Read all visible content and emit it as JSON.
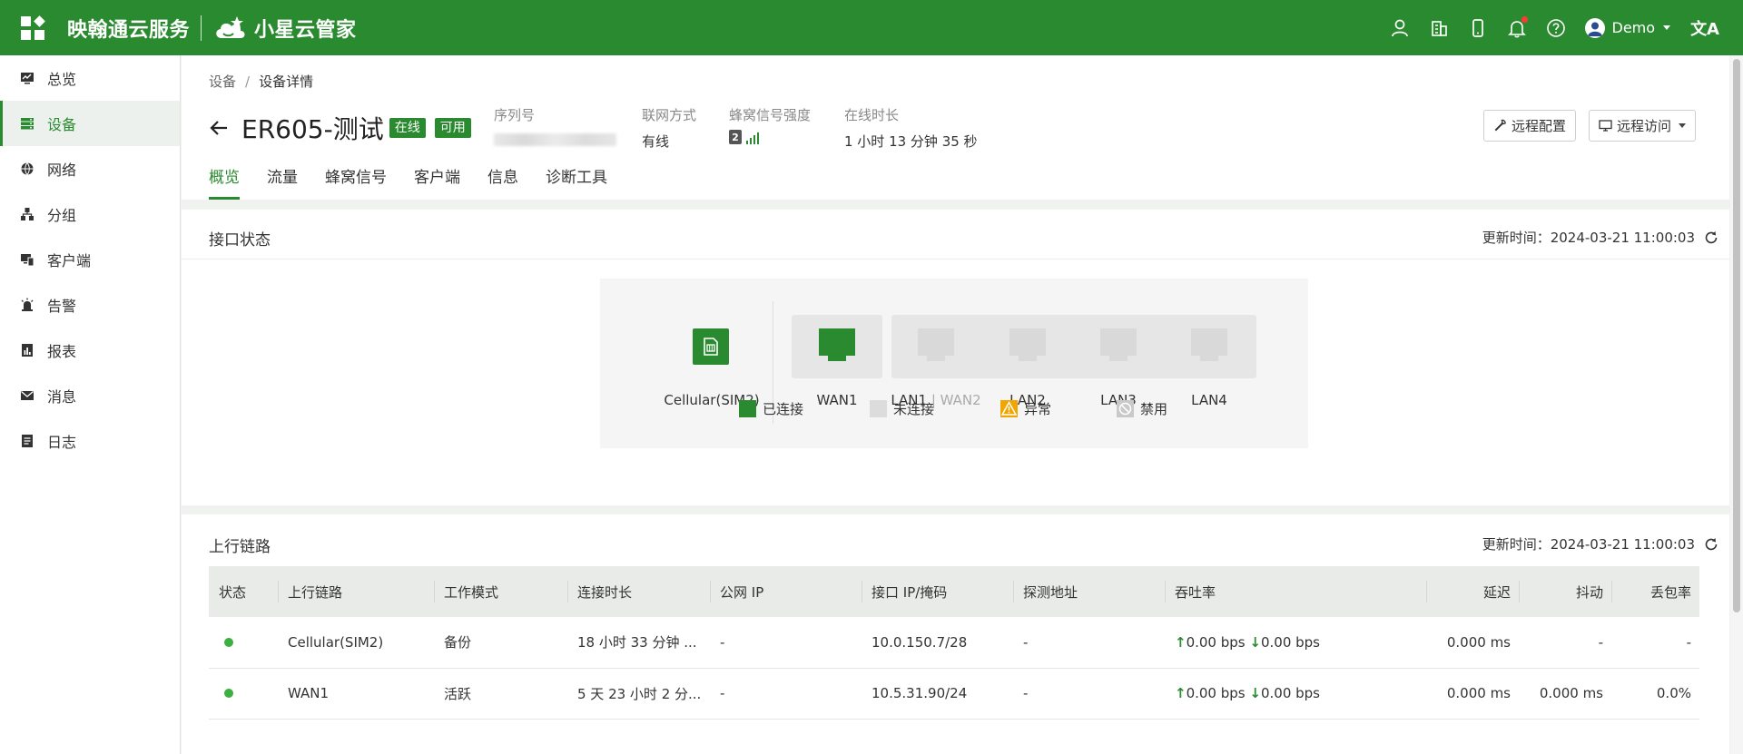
{
  "topbar": {
    "brand": "映翰通云服务",
    "sub_brand": "小星云管家",
    "user": "Demo",
    "lang_glyph": "文A"
  },
  "sidebar": {
    "items": [
      {
        "label": "总览",
        "icon": "dashboard-icon"
      },
      {
        "label": "设备",
        "icon": "device-icon",
        "active": true
      },
      {
        "label": "网络",
        "icon": "globe-icon"
      },
      {
        "label": "分组",
        "icon": "group-icon"
      },
      {
        "label": "客户端",
        "icon": "client-icon"
      },
      {
        "label": "告警",
        "icon": "alarm-icon"
      },
      {
        "label": "报表",
        "icon": "report-icon"
      },
      {
        "label": "消息",
        "icon": "message-icon"
      },
      {
        "label": "日志",
        "icon": "log-icon"
      }
    ]
  },
  "breadcrumb": {
    "parent": "设备",
    "sep": "/",
    "current": "设备详情"
  },
  "device": {
    "name": "ER605-测试",
    "status_online": "在线",
    "status_available": "可用",
    "serial_label": "序列号",
    "net_label": "联网方式",
    "net_value": "有线",
    "signal_label": "蜂窝信号强度",
    "signal_sim": "2",
    "signal_level": 4,
    "uptime_label": "在线时长",
    "uptime_value": "1 小时 13 分钟 35 秒"
  },
  "actions": {
    "remote_config": "远程配置",
    "remote_access": "远程访问"
  },
  "tabs": [
    "概览",
    "流量",
    "蜂窝信号",
    "客户端",
    "信息",
    "诊断工具"
  ],
  "interface": {
    "title": "接口状态",
    "update_label": "更新时间：2024-03-21 11:00:03",
    "sim_label": "Cellular(SIM2)",
    "wan_label": "WAN1",
    "lan1_label": "LAN1",
    "lan1_sep": " | ",
    "lan1_alt": "WAN2",
    "lan2_label": "LAN2",
    "lan3_label": "LAN3",
    "lan4_label": "LAN4",
    "legend": {
      "connected": "已连接",
      "disconnected": "未连接",
      "abnormal": "异常",
      "disabled": "禁用"
    },
    "colors": {
      "connected": "#2a8a2f",
      "disconnected": "#dcdcdc",
      "abnormal": "#f0a500",
      "disabled": "#c9c9c9"
    }
  },
  "uplink": {
    "title": "上行链路",
    "update_label": "更新时间：2024-03-21 11:00:03",
    "headers": [
      "状态",
      "上行链路",
      "工作模式",
      "连接时长",
      "公网 IP",
      "接口 IP/掩码",
      "探测地址",
      "吞吐率",
      "延迟",
      "抖动",
      "丢包率"
    ],
    "rows": [
      {
        "name": "Cellular(SIM2)",
        "mode": "备份",
        "duration": "18 小时 33 分钟 ...",
        "public_ip": "-",
        "iface_ip": "10.0.150.7/28",
        "probe": "-",
        "tx": "0.00 bps",
        "rx": "0.00 bps",
        "latency": "0.000 ms",
        "jitter": "-",
        "loss": "-"
      },
      {
        "name": "WAN1",
        "mode": "活跃",
        "duration": "5 天 23 小时 2 分...",
        "public_ip": "-",
        "iface_ip": "10.5.31.90/24",
        "probe": "-",
        "tx": "0.00 bps",
        "rx": "0.00 bps",
        "latency": "0.000 ms",
        "jitter": "0.000 ms",
        "loss": "0.0%"
      }
    ]
  }
}
